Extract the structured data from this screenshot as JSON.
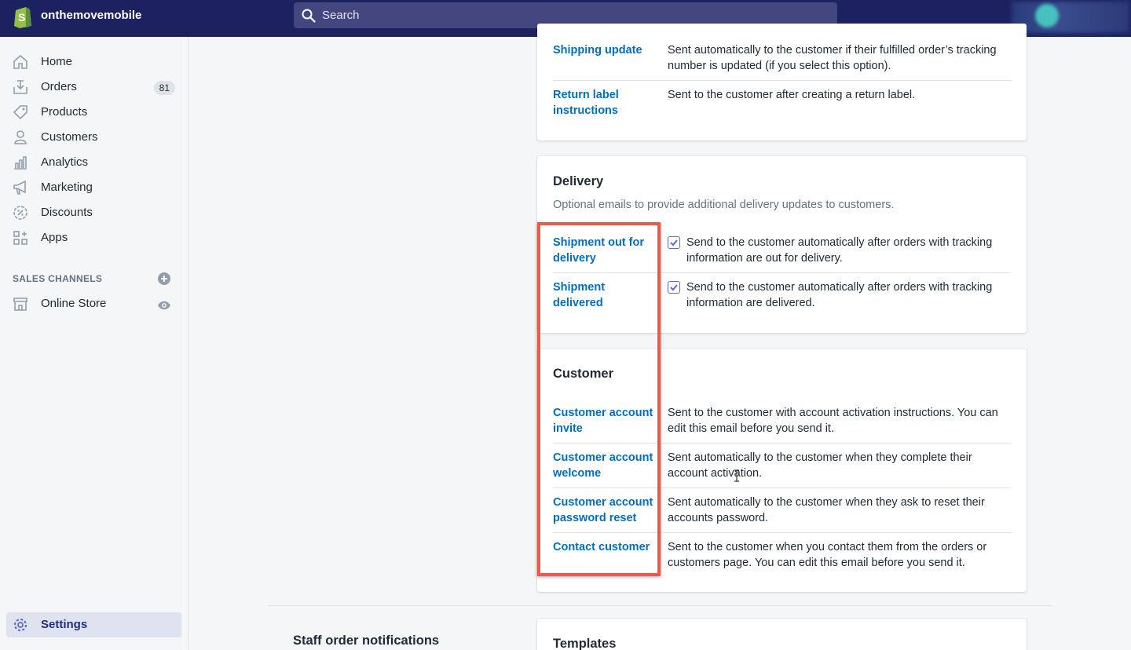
{
  "store": {
    "name": "onthemovemobile"
  },
  "search": {
    "placeholder": "Search"
  },
  "sidebar": {
    "items": [
      {
        "label": "Home",
        "icon": "home-icon"
      },
      {
        "label": "Orders",
        "icon": "orders-icon",
        "badge": "81"
      },
      {
        "label": "Products",
        "icon": "tag-icon"
      },
      {
        "label": "Customers",
        "icon": "person-icon"
      },
      {
        "label": "Analytics",
        "icon": "bar-chart-icon"
      },
      {
        "label": "Marketing",
        "icon": "megaphone-icon"
      },
      {
        "label": "Discounts",
        "icon": "discount-icon"
      },
      {
        "label": "Apps",
        "icon": "apps-icon"
      }
    ],
    "sales_channels_heading": "SALES CHANNELS",
    "online_store": {
      "label": "Online Store",
      "icon": "store-icon"
    },
    "settings": {
      "label": "Settings",
      "icon": "gear-icon"
    }
  },
  "shipping_card": {
    "rows": [
      {
        "title": "Shipping update",
        "desc": "Sent automatically to the customer if their fulfilled order’s tracking number is updated (if you select this option)."
      },
      {
        "title": "Return label instructions",
        "desc": "Sent to the customer after creating a return label."
      }
    ]
  },
  "delivery_card": {
    "title": "Delivery",
    "subtitle": "Optional emails to provide additional delivery updates to customers.",
    "rows": [
      {
        "title": "Shipment out for delivery",
        "desc": "Send to the customer automatically after orders with tracking information are out for delivery.",
        "checked": true
      },
      {
        "title": "Shipment delivered",
        "desc": "Send to the customer automatically after orders with tracking information are delivered.",
        "checked": true
      }
    ]
  },
  "customer_card": {
    "title": "Customer",
    "rows": [
      {
        "title": "Customer account invite",
        "desc": "Sent to the customer with account activation instructions. You can edit this email before you send it."
      },
      {
        "title": "Customer account welcome",
        "desc": "Sent automatically to the customer when they complete their account activation."
      },
      {
        "title": "Customer account password reset",
        "desc": "Sent automatically to the customer when they ask to reset their accounts password."
      },
      {
        "title": "Contact customer",
        "desc": "Sent to the customer when you contact them from the orders or customers page. You can edit this email before you send it."
      }
    ]
  },
  "staff_section": {
    "title": "Staff order notifications"
  },
  "templates_card": {
    "title": "Templates"
  },
  "colors": {
    "topbar": "#1c2260",
    "link": "#006fbb",
    "highlight": "#e95a4b",
    "active_nav": "#202e78"
  }
}
